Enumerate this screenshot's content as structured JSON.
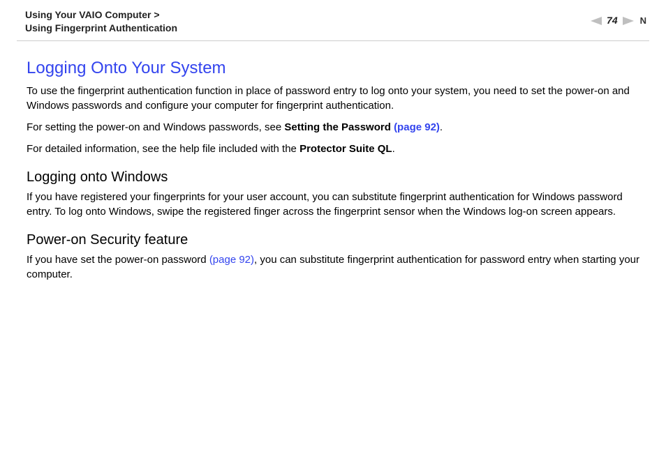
{
  "header": {
    "crumb1": "Using Your VAIO Computer",
    "chev": ">",
    "crumb2": "Using Fingerprint Authentication",
    "page_number": "74",
    "n_letter": "N"
  },
  "main": {
    "title": "Logging Onto Your System",
    "p1": "To use the fingerprint authentication function in place of password entry to log onto your system, you need to set the power-on and Windows passwords and configure your computer for fingerprint authentication.",
    "p2a": "For setting the power-on and Windows passwords, see ",
    "p2b": "Setting the Password ",
    "p2c": "(page 92)",
    "p2d": ".",
    "p3a": "For detailed information, see the help file included with the ",
    "p3b": "Protector Suite QL",
    "p3c": ".",
    "sub1": "Logging onto Windows",
    "p4": "If you have registered your fingerprints for your user account, you can substitute fingerprint authentication for Windows password entry. To log onto Windows, swipe the registered finger across the fingerprint sensor when the Windows log-on screen appears.",
    "sub2": "Power-on Security feature",
    "p5a": "If you have set the power-on password ",
    "p5b": "(page 92)",
    "p5c": ", you can substitute fingerprint authentication for password entry when starting your computer."
  }
}
